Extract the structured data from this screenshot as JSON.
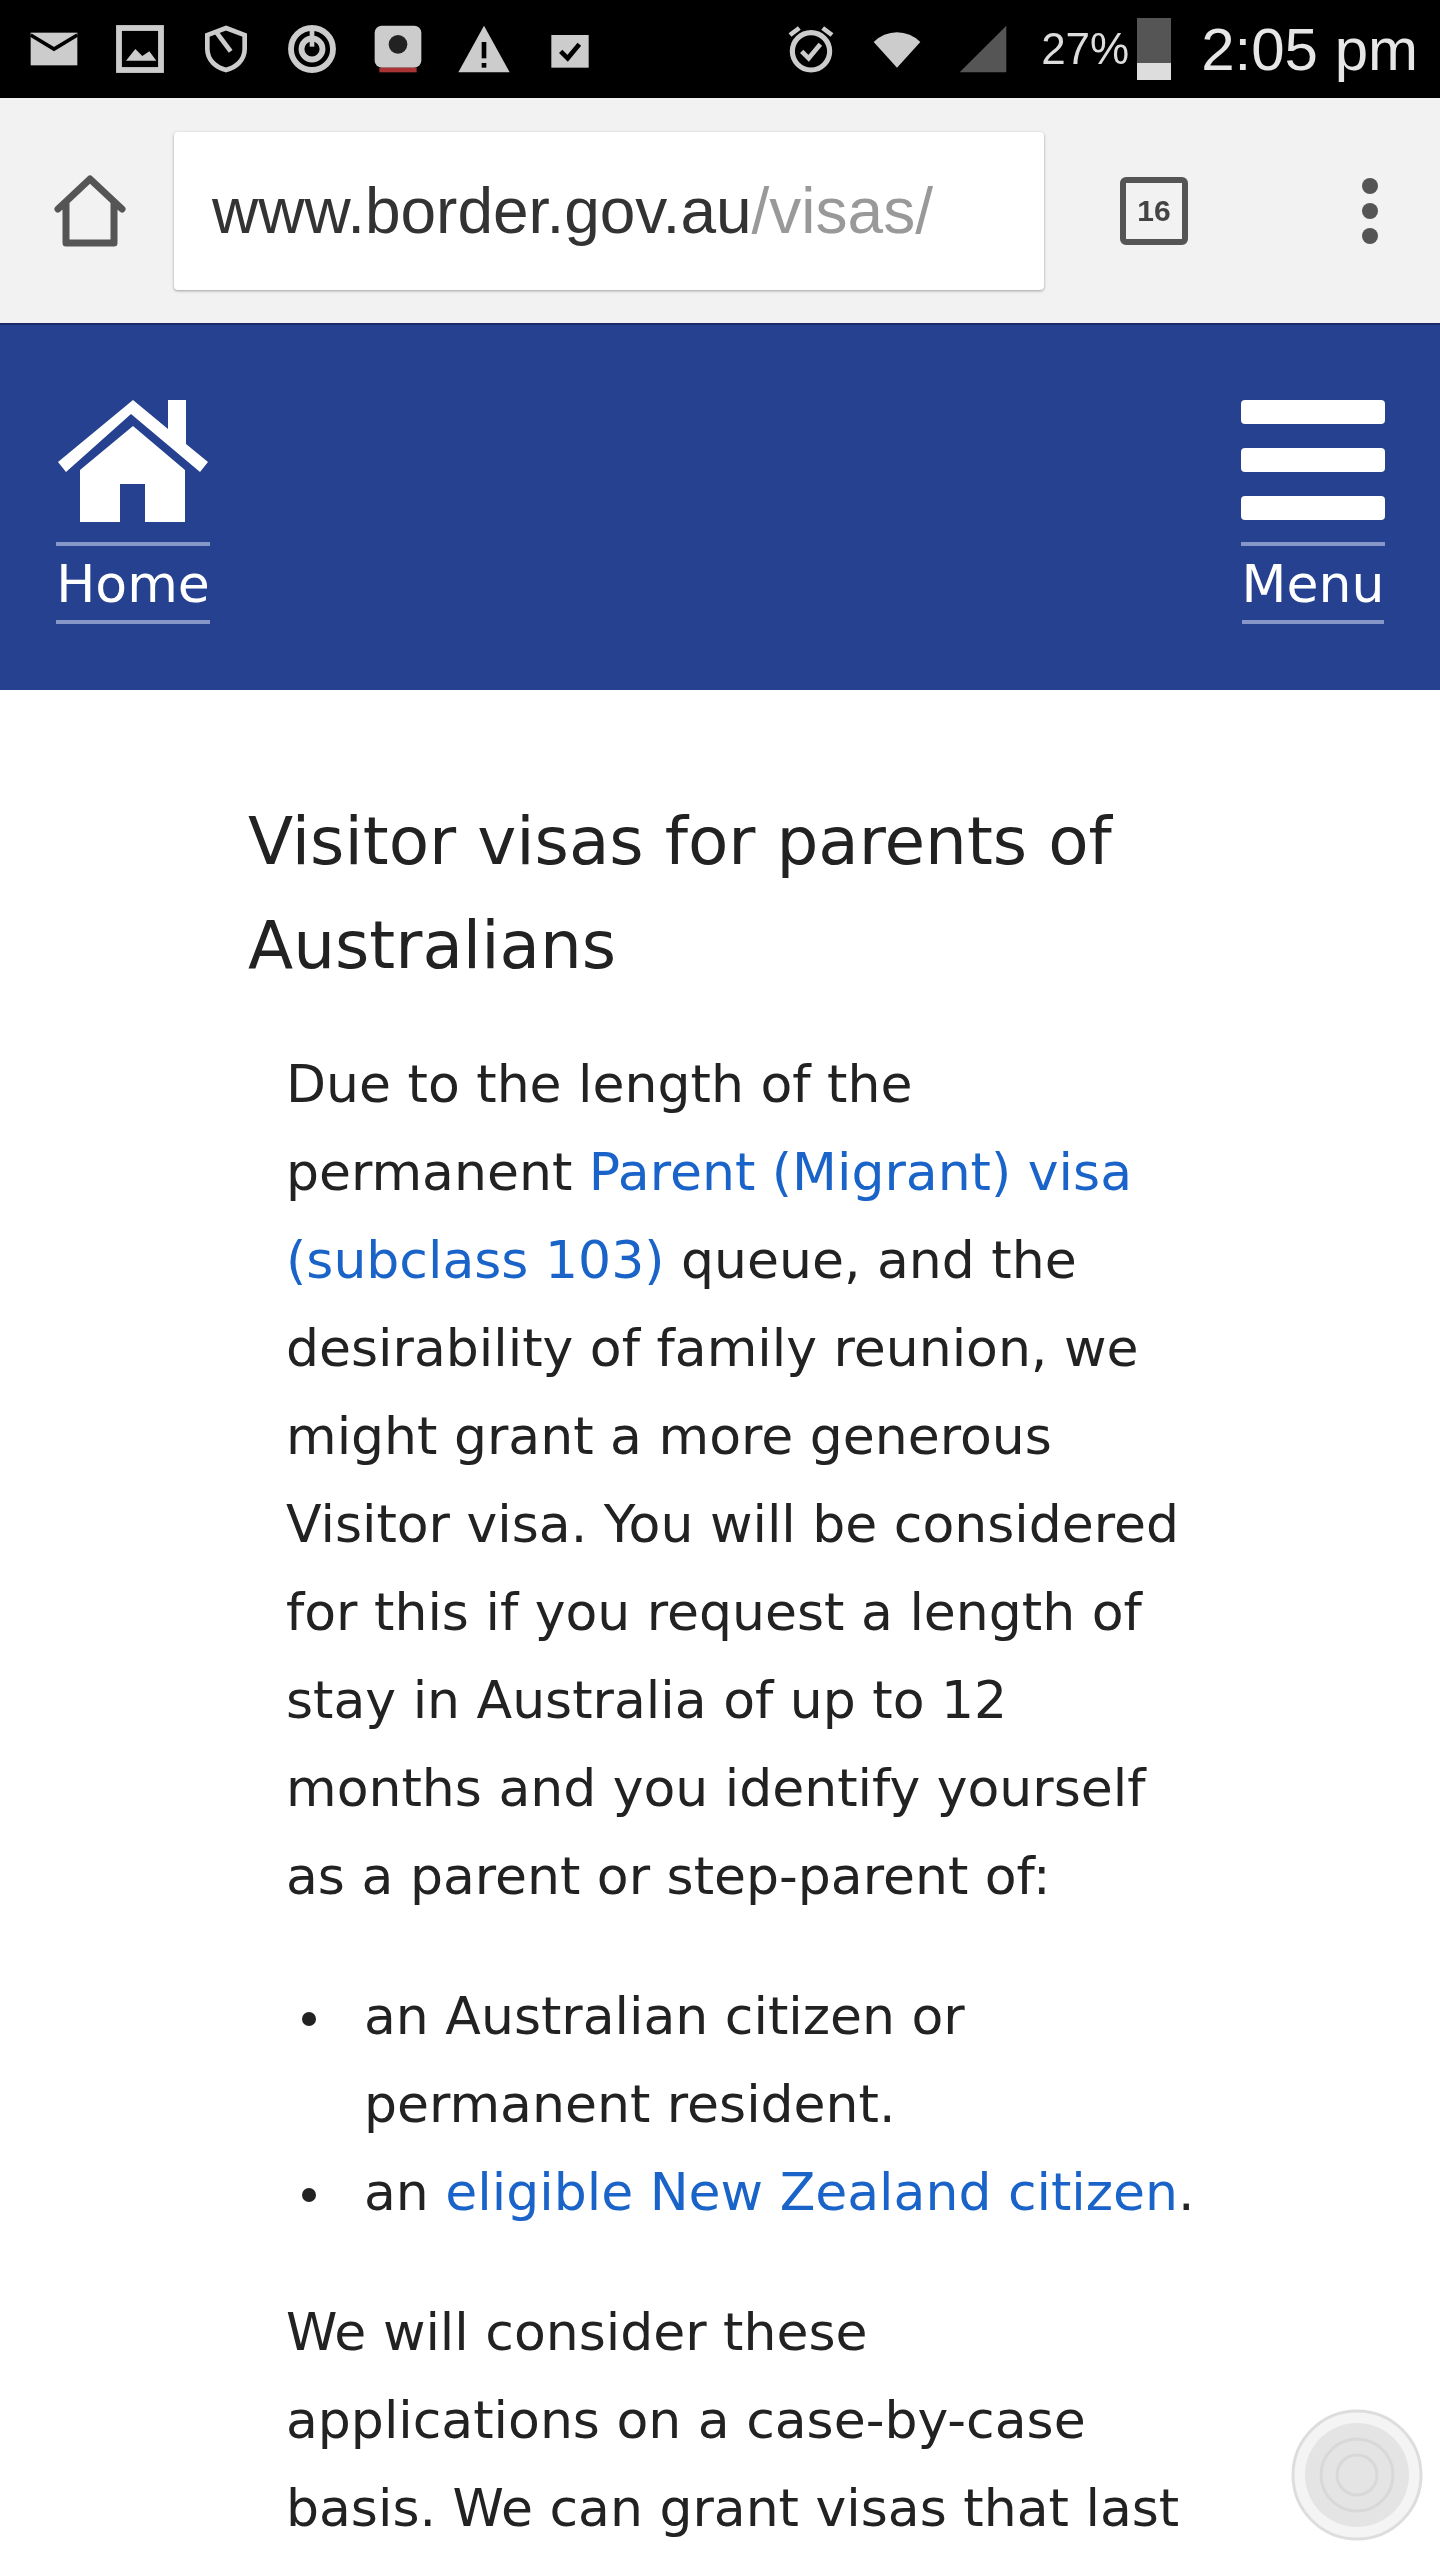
{
  "status_bar": {
    "battery": "27%",
    "time": "2:05 pm"
  },
  "browser": {
    "url_host": "www.border.gov.au",
    "url_path": "/visas/",
    "tab_count": "16"
  },
  "header": {
    "home_label": "Home",
    "menu_label": "Menu"
  },
  "article": {
    "title": "Visitor visas for parents of Australians",
    "intro": [
      {
        "kind": "text",
        "text": "Due to the length of the permanent "
      },
      {
        "kind": "link",
        "text": "Parent (Migrant) visa "
      },
      {
        "kind": "link",
        "text": "(subclass 103)"
      },
      {
        "kind": "text",
        "text": " queue, and the desirability of family reunion, we might grant a more generous Visitor visa. You will be considered for this if you request a length of stay in Australia of up to 12 months and you identify yourself as a parent or step-parent of:"
      }
    ],
    "bullets": [
      [
        {
          "kind": "text",
          "text": "an Australian citizen or permanent resident."
        }
      ],
      [
        {
          "kind": "text",
          "text": "an "
        },
        {
          "kind": "link",
          "text": "eligible New Zealand citizen"
        },
        {
          "kind": "text",
          "text": "."
        }
      ]
    ],
    "closing": "We will consider these applications on a case-by-case basis. We can grant visas that last"
  }
}
